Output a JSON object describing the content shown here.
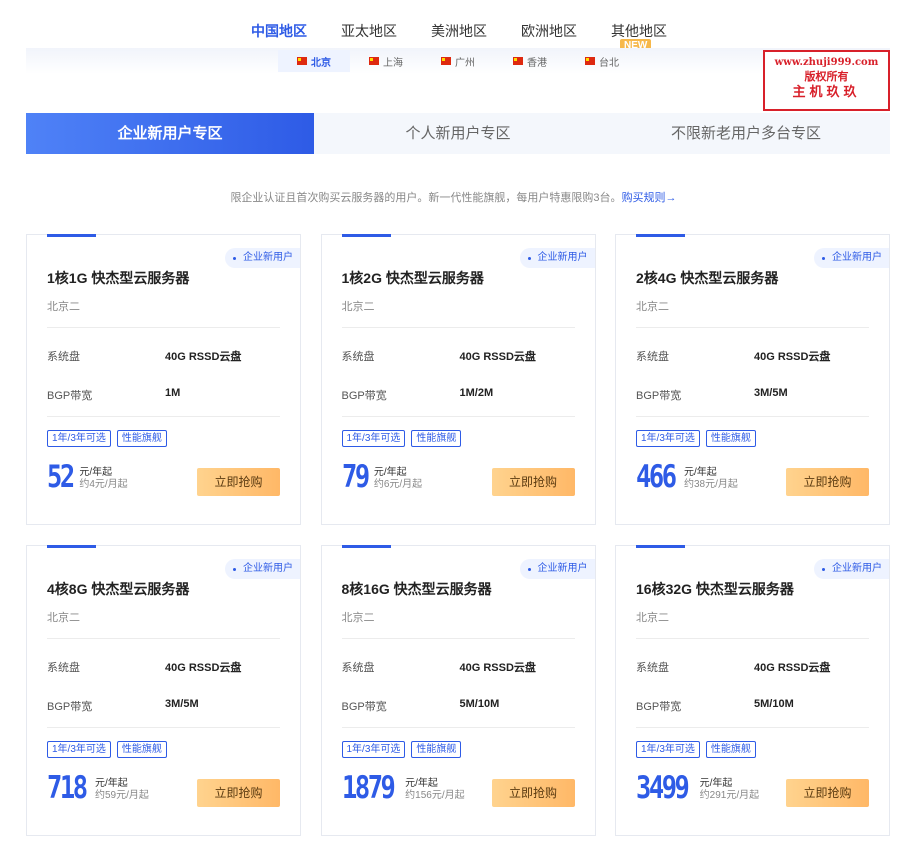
{
  "region_tabs": [
    {
      "label": "中国地区",
      "active": true
    },
    {
      "label": "亚太地区",
      "active": false
    },
    {
      "label": "美洲地区",
      "active": false
    },
    {
      "label": "欧洲地区",
      "active": false
    },
    {
      "label": "其他地区",
      "active": false
    }
  ],
  "new_badge": "NEW",
  "cities": [
    {
      "label": "北京",
      "active": true
    },
    {
      "label": "上海",
      "active": false
    },
    {
      "label": "广州",
      "active": false
    },
    {
      "label": "香港",
      "active": false
    },
    {
      "label": "台北",
      "active": false
    }
  ],
  "watermark": {
    "url": "www.zhuji999.com",
    "rights": "版权所有",
    "name": "主机玖玖"
  },
  "zone_tabs": [
    {
      "label": "企业新用户专区",
      "active": true
    },
    {
      "label": "个人新用户专区",
      "active": false
    },
    {
      "label": "不限新老用户多台专区",
      "active": false
    }
  ],
  "description": {
    "text": "限企业认证且首次购买云服务器的用户。新一代性能旗舰，每用户特惠限购3台。",
    "link": "购买规则→"
  },
  "colors": {
    "accent": "#2e5be6",
    "buy_button": "#ffc57a",
    "watermark_red": "#d8202a"
  },
  "cards": [
    {
      "badge": "企业新用户",
      "title": "1核1G 快杰型云服务器",
      "zone": "北京二",
      "disk_label": "系统盘",
      "disk_value": "40G RSSD云盘",
      "bw_label": "BGP带宽",
      "bw_value": "1M",
      "tags": [
        "1年/3年可选",
        "性能旗舰"
      ],
      "price": "52",
      "price_unit": "元/年起",
      "monthly": "约4元/月起",
      "buy_label": "立即抢购"
    },
    {
      "badge": "企业新用户",
      "title": "1核2G 快杰型云服务器",
      "zone": "北京二",
      "disk_label": "系统盘",
      "disk_value": "40G RSSD云盘",
      "bw_label": "BGP带宽",
      "bw_value": "1M/2M",
      "tags": [
        "1年/3年可选",
        "性能旗舰"
      ],
      "price": "79",
      "price_unit": "元/年起",
      "monthly": "约6元/月起",
      "buy_label": "立即抢购"
    },
    {
      "badge": "企业新用户",
      "title": "2核4G 快杰型云服务器",
      "zone": "北京二",
      "disk_label": "系统盘",
      "disk_value": "40G RSSD云盘",
      "bw_label": "BGP带宽",
      "bw_value": "3M/5M",
      "tags": [
        "1年/3年可选",
        "性能旗舰"
      ],
      "price": "466",
      "price_unit": "元/年起",
      "monthly": "约38元/月起",
      "buy_label": "立即抢购"
    },
    {
      "badge": "企业新用户",
      "title": "4核8G 快杰型云服务器",
      "zone": "北京二",
      "disk_label": "系统盘",
      "disk_value": "40G RSSD云盘",
      "bw_label": "BGP带宽",
      "bw_value": "3M/5M",
      "tags": [
        "1年/3年可选",
        "性能旗舰"
      ],
      "price": "718",
      "price_unit": "元/年起",
      "monthly": "约59元/月起",
      "buy_label": "立即抢购"
    },
    {
      "badge": "企业新用户",
      "title": "8核16G 快杰型云服务器",
      "zone": "北京二",
      "disk_label": "系统盘",
      "disk_value": "40G RSSD云盘",
      "bw_label": "BGP带宽",
      "bw_value": "5M/10M",
      "tags": [
        "1年/3年可选",
        "性能旗舰"
      ],
      "price": "1879",
      "price_unit": "元/年起",
      "monthly": "约156元/月起",
      "buy_label": "立即抢购"
    },
    {
      "badge": "企业新用户",
      "title": "16核32G 快杰型云服务器",
      "zone": "北京二",
      "disk_label": "系统盘",
      "disk_value": "40G RSSD云盘",
      "bw_label": "BGP带宽",
      "bw_value": "5M/10M",
      "tags": [
        "1年/3年可选",
        "性能旗舰"
      ],
      "price": "3499",
      "price_unit": "元/年起",
      "monthly": "约291元/月起",
      "buy_label": "立即抢购"
    }
  ]
}
